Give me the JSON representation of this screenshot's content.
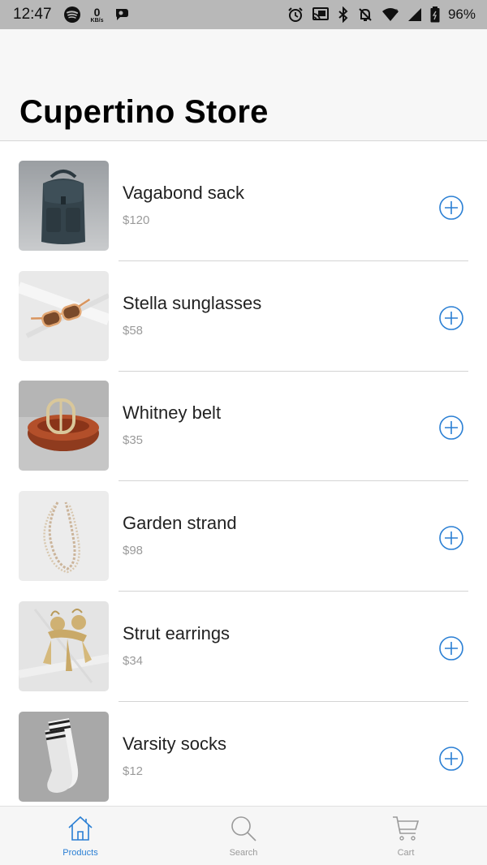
{
  "status_bar": {
    "time": "12:47",
    "network_speed_value": "0",
    "network_speed_unit": "KB/s",
    "battery_percent": "96%",
    "icons": [
      "spotify-icon",
      "network-speed-icon",
      "app-notification-icon",
      "alarm-icon",
      "cast-icon",
      "bluetooth-icon",
      "do-not-disturb-icon",
      "wifi-icon",
      "signal-icon",
      "battery-icon"
    ]
  },
  "nav": {
    "title": "Cupertino Store"
  },
  "products": [
    {
      "name": "Vagabond sack",
      "price": "$120",
      "image": "backpack"
    },
    {
      "name": "Stella sunglasses",
      "price": "$58",
      "image": "sunglasses"
    },
    {
      "name": "Whitney belt",
      "price": "$35",
      "image": "belt"
    },
    {
      "name": "Garden strand",
      "price": "$98",
      "image": "necklace"
    },
    {
      "name": "Strut earrings",
      "price": "$34",
      "image": "earrings"
    },
    {
      "name": "Varsity socks",
      "price": "$12",
      "image": "socks"
    }
  ],
  "tabs": [
    {
      "label": "Products",
      "icon": "home-icon",
      "active": true
    },
    {
      "label": "Search",
      "icon": "search-icon",
      "active": false
    },
    {
      "label": "Cart",
      "icon": "cart-icon",
      "active": false
    }
  ],
  "colors": {
    "accent": "#2a7fd4",
    "inactive": "#9a9a9a",
    "status_bar": "#b8b8b8",
    "nav_background": "#f7f7f7",
    "title": "#000000",
    "divider": "#d4d4d4"
  }
}
